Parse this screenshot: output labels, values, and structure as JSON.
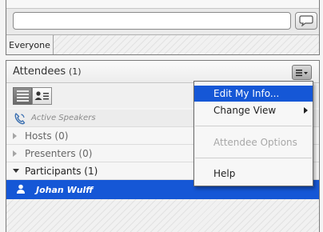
{
  "chat": {
    "input_value": "",
    "recipient_tab": "Everyone"
  },
  "attendees": {
    "title": "Attendees",
    "count": "(1)",
    "active_speakers_label": "Active Speakers",
    "roles": [
      {
        "label": "Hosts (0)",
        "expanded": false
      },
      {
        "label": "Presenters (0)",
        "expanded": false
      },
      {
        "label": "Participants (1)",
        "expanded": true
      }
    ],
    "selected_attendee": "Johan Wulff"
  },
  "pod_menu": {
    "items": [
      {
        "label": "Edit My Info...",
        "state": "highlighted"
      },
      {
        "label": "Change View",
        "state": "submenu"
      },
      {
        "label": "Attendee Options",
        "state": "disabled"
      },
      {
        "label": "Help",
        "state": "normal"
      }
    ]
  },
  "icons": {
    "send": "speech-bubble-icon",
    "menu": "pod-menu-icon",
    "list_view": "list-view-icon",
    "detail_view": "detail-view-icon",
    "phone": "phone-icon",
    "user": "user-icon"
  },
  "colors": {
    "selection": "#1557d6",
    "disabled_text": "#a8a8a8"
  }
}
